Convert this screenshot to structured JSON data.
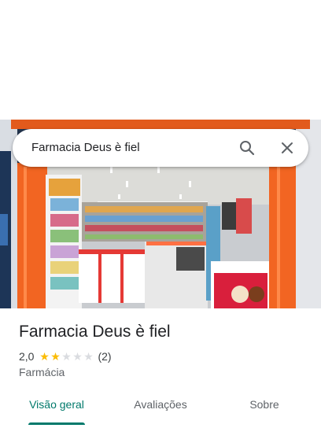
{
  "search": {
    "query": "Farmacia Deus è fiel"
  },
  "place": {
    "name": "Farmacia Deus è fiel",
    "rating": "2,0",
    "rating_value": 2,
    "rating_max": 5,
    "review_count": "(2)",
    "category": "Farmácia"
  },
  "tabs": [
    {
      "label": "Visão geral",
      "active": true
    },
    {
      "label": "Avaliações",
      "active": false
    },
    {
      "label": "Sobre",
      "active": false
    }
  ],
  "colors": {
    "accent": "#00796b",
    "star": "#fbbc04",
    "star_empty": "#dadce0",
    "storefront_orange": "#f26522"
  },
  "icons": {
    "search": "search-icon",
    "close": "close-icon"
  }
}
